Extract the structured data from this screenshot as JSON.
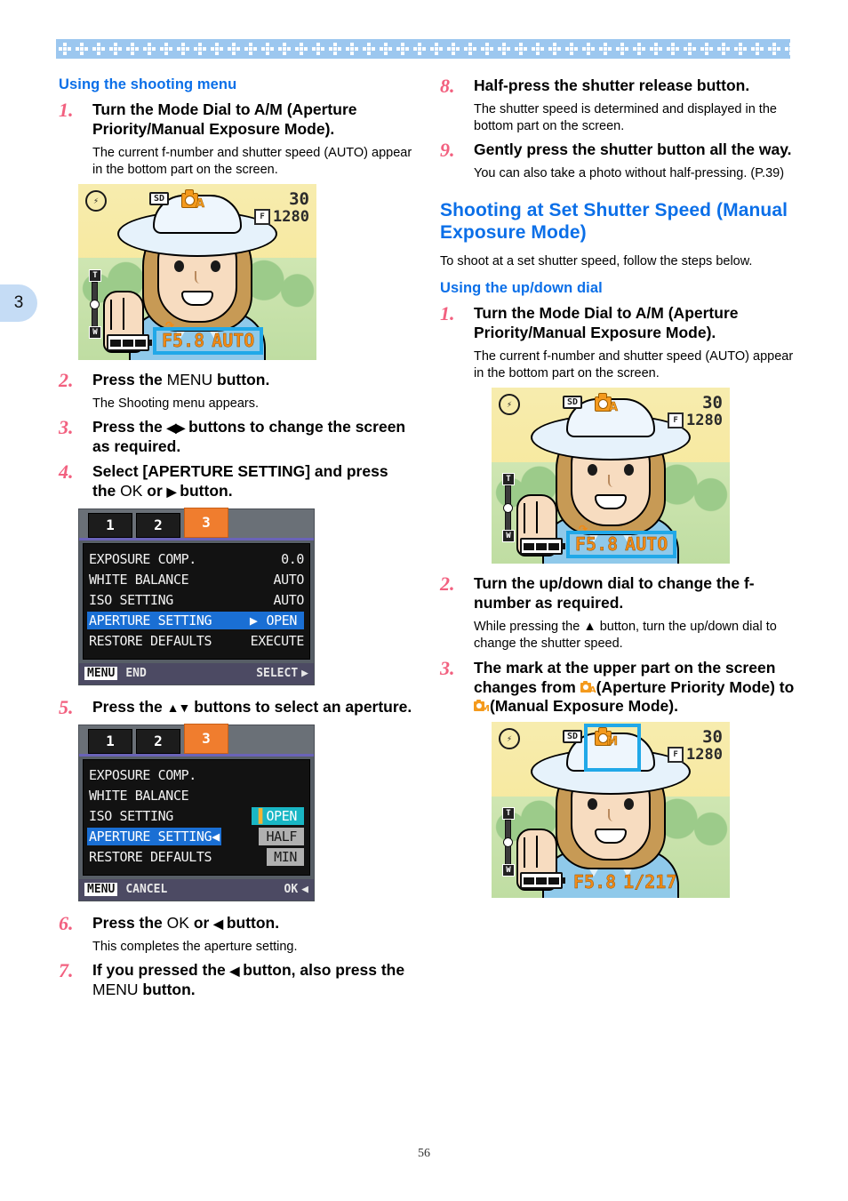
{
  "page": {
    "number": "56",
    "chapter_tab": "3",
    "accent_blue": "#0b6fe8",
    "accent_pink": "#f2607f",
    "band_blue": "#9cc7ef",
    "menu_orange": "#f07d2e",
    "osd_orange": "#f08a16",
    "highlight_cyan": "#21a8e8"
  },
  "left_column": {
    "subheading": "Using the shooting menu",
    "steps": [
      {
        "num": "1.",
        "title_a": "Turn the Mode Dial to A/M (Aperture Priority/Manual Exposure Mode).",
        "body": "The current f-number and shutter speed (AUTO) appear in the bottom part on the screen."
      },
      {
        "num": "2.",
        "title_a": "Press the ",
        "title_mono": "MENU",
        "title_b": " button.",
        "body": "The Shooting menu appears."
      },
      {
        "num": "3.",
        "title_a": "Press the ",
        "title_glyph": "◀▶",
        "title_b": " buttons to change the screen as required."
      },
      {
        "num": "4.",
        "title_a": "Select [APERTURE SETTING] and press the ",
        "title_mono": "OK",
        "title_mid": " or ",
        "title_glyph": "▶",
        "title_b": " button."
      },
      {
        "num": "5.",
        "title_a": "Press the ",
        "title_glyph": "▲▼",
        "title_b": " buttons to select an aperture."
      },
      {
        "num": "6.",
        "title_a": "Press the ",
        "title_mono": "OK",
        "title_mid": " or ",
        "title_glyph": "◀",
        "title_b": " button.",
        "body": "This completes the aperture setting."
      },
      {
        "num": "7.",
        "title_a": "If you pressed the ",
        "title_glyph": "◀",
        "title_mid": " button, also press the ",
        "title_mono": "MENU",
        "title_b": " button."
      }
    ]
  },
  "right_column": {
    "steps_continued": [
      {
        "num": "8.",
        "title": "Half-press the shutter release button.",
        "body": "The shutter speed is determined and displayed in the bottom part on the screen."
      },
      {
        "num": "9.",
        "title": "Gently press the shutter button all the way.",
        "body": "You can also take a photo without half-pressing. (P.39)"
      }
    ],
    "section_heading": "Shooting at Set Shutter Speed (Manual Exposure Mode)",
    "section_intro": "To shoot at a set shutter speed, follow the steps below.",
    "subheading": "Using the up/down dial",
    "steps": [
      {
        "num": "1.",
        "title": "Turn the Mode Dial to A/M (Aperture Priority/Manual Exposure Mode).",
        "body": "The current f-number and shutter speed (AUTO) appear in the bottom part on the screen."
      },
      {
        "num": "2.",
        "title": "Turn the up/down dial to change the f-number as required.",
        "body_a": "While pressing the ",
        "body_glyph": "▲",
        "body_b": " button, turn the up/down dial to change the shutter speed."
      },
      {
        "num": "3.",
        "title_a": "The mark at the upper part on the screen changes from ",
        "title_mid": "(Aperture Priority Mode) to ",
        "title_b": "(Manual Exposure Mode).",
        "icon_a_letter": "A",
        "icon_b_letter": "M"
      }
    ]
  },
  "lcd_screens": [
    {
      "id": "lcd-aperture-auto-left",
      "flash_icon": "flash-off-icon",
      "card_badge": "SD",
      "mode_letter": "A",
      "shots_remaining": "30",
      "quality_badge": "F",
      "image_size": "1280",
      "zoom_top_label": "T",
      "zoom_bottom_label": "W",
      "f_number": "F5.8",
      "shutter_speed": "AUTO",
      "exposure_highlighted": true,
      "mode_highlighted": false
    },
    {
      "id": "lcd-aperture-auto-right",
      "flash_icon": "flash-off-icon",
      "card_badge": "SD",
      "mode_letter": "A",
      "shots_remaining": "30",
      "quality_badge": "F",
      "image_size": "1280",
      "zoom_top_label": "T",
      "zoom_bottom_label": "W",
      "f_number": "F5.8",
      "shutter_speed": "AUTO",
      "exposure_highlighted": true,
      "mode_highlighted": false
    },
    {
      "id": "lcd-manual-right",
      "flash_icon": "flash-off-icon",
      "card_badge": "SD",
      "mode_letter": "M",
      "shots_remaining": "30",
      "quality_badge": "F",
      "image_size": "1280",
      "zoom_top_label": "T",
      "zoom_bottom_label": "W",
      "f_number": "F5.8",
      "shutter_speed": "1/217",
      "exposure_highlighted": false,
      "mode_highlighted": true
    }
  ],
  "menu_screens": [
    {
      "id": "menu-aperture-setting-open",
      "tabs": [
        "1",
        "2",
        "3"
      ],
      "active_tab": "3",
      "rows": [
        {
          "label": "EXPOSURE COMP.",
          "value": "0.0",
          "selected": false
        },
        {
          "label": "WHITE BALANCE",
          "value": "AUTO",
          "selected": false
        },
        {
          "label": "ISO SETTING",
          "value": "AUTO",
          "selected": false
        },
        {
          "label": "APERTURE SETTING",
          "caret": "▶",
          "value": "OPEN",
          "selected": true
        },
        {
          "label": "RESTORE DEFAULTS",
          "value": "EXECUTE",
          "selected": false
        }
      ],
      "bottom_left_key": "MENU",
      "bottom_left_label": "END",
      "bottom_right_label": "SELECT",
      "bottom_right_glyph": "▶"
    },
    {
      "id": "menu-aperture-options",
      "tabs": [
        "1",
        "2",
        "3"
      ],
      "active_tab": "3",
      "rows": [
        {
          "label": "EXPOSURE COMP.",
          "value": "",
          "selected": false
        },
        {
          "label": "WHITE BALANCE",
          "value": "",
          "selected": false
        },
        {
          "label": "ISO SETTING",
          "value": "OPEN",
          "selected": false,
          "style": "teal"
        },
        {
          "label": "APERTURE SETTING",
          "caret": "◀",
          "value": "HALF",
          "selected": true,
          "style": "gray"
        },
        {
          "label": "RESTORE DEFAULTS",
          "value": "MIN",
          "selected": false,
          "style": "gray"
        }
      ],
      "bottom_left_key": "MENU",
      "bottom_left_label": "CANCEL",
      "bottom_right_label": "OK",
      "bottom_right_glyph": "◀"
    }
  ]
}
